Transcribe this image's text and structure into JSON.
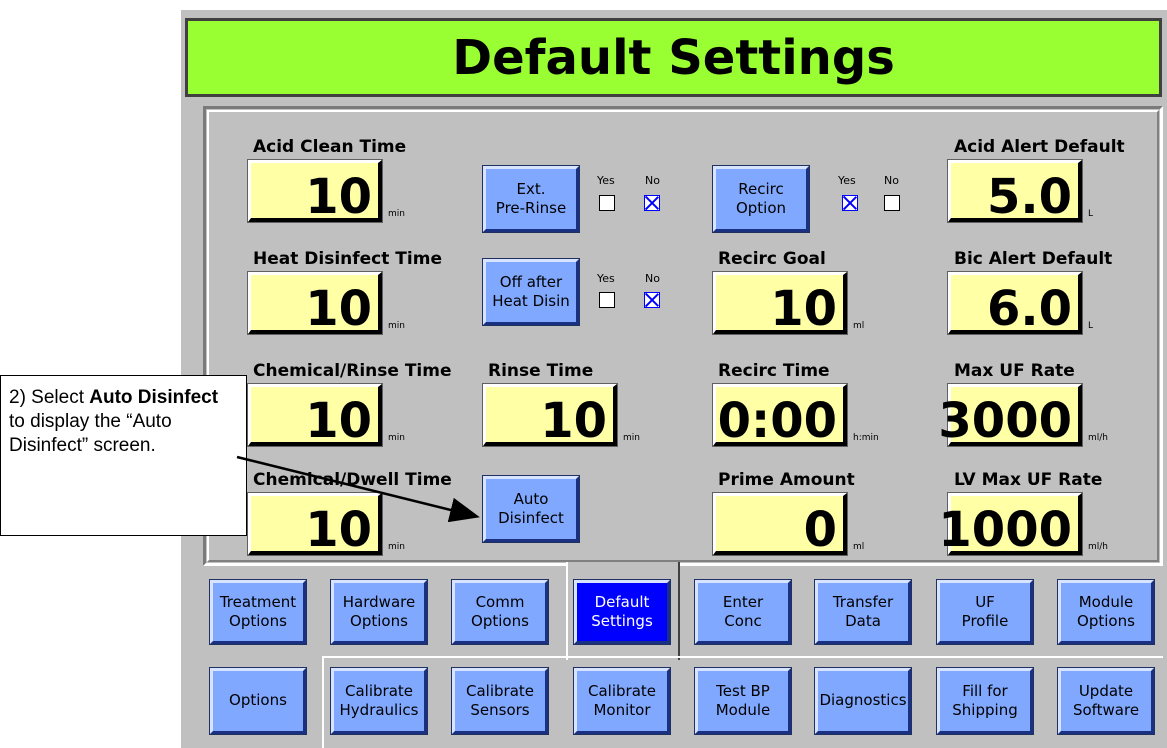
{
  "title": "Default Settings",
  "fields": {
    "acid_clean_time": {
      "label": "Acid  Clean  Time",
      "value": "10",
      "unit": "min"
    },
    "heat_disinfect_time": {
      "label": "Heat  Disinfect  Time",
      "value": "10",
      "unit": "min"
    },
    "chemical_rinse_time": {
      "label": "Chemical/Rinse  Time",
      "value": "10",
      "unit": "min"
    },
    "chemical_dwell_time": {
      "label": "Chemical/Dwell  Time",
      "value": "10",
      "unit": "min"
    },
    "rinse_time": {
      "label": "Rinse  Time",
      "value": "10",
      "unit": "min"
    },
    "recirc_goal": {
      "label": "Recirc  Goal",
      "value": "10",
      "unit": "ml"
    },
    "recirc_time": {
      "label": "Recirc  Time",
      "value": "0:00",
      "unit": "h:min"
    },
    "prime_amount": {
      "label": "Prime  Amount",
      "value": "0",
      "unit": "ml"
    },
    "acid_alert_default": {
      "label": "Acid  Alert  Default",
      "value": "5.0",
      "unit": "L"
    },
    "bic_alert_default": {
      "label": "Bic  Alert  Default",
      "value": "6.0",
      "unit": "L"
    },
    "max_uf_rate": {
      "label": "Max  UF  Rate",
      "value": "3000",
      "unit": "ml/h"
    },
    "lv_max_uf_rate": {
      "label": "LV  Max  UF  Rate",
      "value": "1000",
      "unit": "ml/h"
    }
  },
  "option_buttons": {
    "ext_pre_rinse": {
      "line1": "Ext.",
      "line2": "Pre-Rinse",
      "yes": "Yes",
      "no": "No",
      "selected": "No"
    },
    "off_after_heat_disin": {
      "line1": "Off after",
      "line2": "Heat Disin",
      "yes": "Yes",
      "no": "No",
      "selected": "No"
    },
    "recirc_option": {
      "line1": "Recirc",
      "line2": "Option",
      "yes": "Yes",
      "no": "No",
      "selected": "Yes"
    },
    "auto_disinfect": {
      "line1": "Auto",
      "line2": "Disinfect"
    }
  },
  "tabs_row1": [
    {
      "line1": "Treatment",
      "line2": "Options"
    },
    {
      "line1": "Hardware",
      "line2": "Options"
    },
    {
      "line1": "Comm",
      "line2": "Options"
    },
    {
      "line1": "Default",
      "line2": "Settings",
      "active": true
    },
    {
      "line1": "Enter",
      "line2": "Conc"
    },
    {
      "line1": "Transfer",
      "line2": "Data"
    },
    {
      "line1": "UF",
      "line2": "Profile"
    },
    {
      "line1": "Module",
      "line2": "Options"
    }
  ],
  "tabs_row2": [
    {
      "line1": "Options",
      "line2": ""
    },
    {
      "line1": "Calibrate",
      "line2": "Hydraulics"
    },
    {
      "line1": "Calibrate",
      "line2": "Sensors"
    },
    {
      "line1": "Calibrate",
      "line2": "Monitor"
    },
    {
      "line1": "Test BP",
      "line2": "Module"
    },
    {
      "line1": "Diagnostics",
      "line2": ""
    },
    {
      "line1": "Fill for",
      "line2": "Shipping"
    },
    {
      "line1": "Update",
      "line2": "Software"
    }
  ],
  "callout": {
    "prefix": "2) Select ",
    "bold": "Auto Disinfect",
    "suffix": " to display the “Auto Disinfect” screen."
  },
  "colors": {
    "title_bg": "#99ff33",
    "field_bg": "#ffffa6",
    "button_bg": "#80a8ff",
    "active_tab_bg": "#0000ff",
    "screen_bg": "#c0c0c0"
  }
}
